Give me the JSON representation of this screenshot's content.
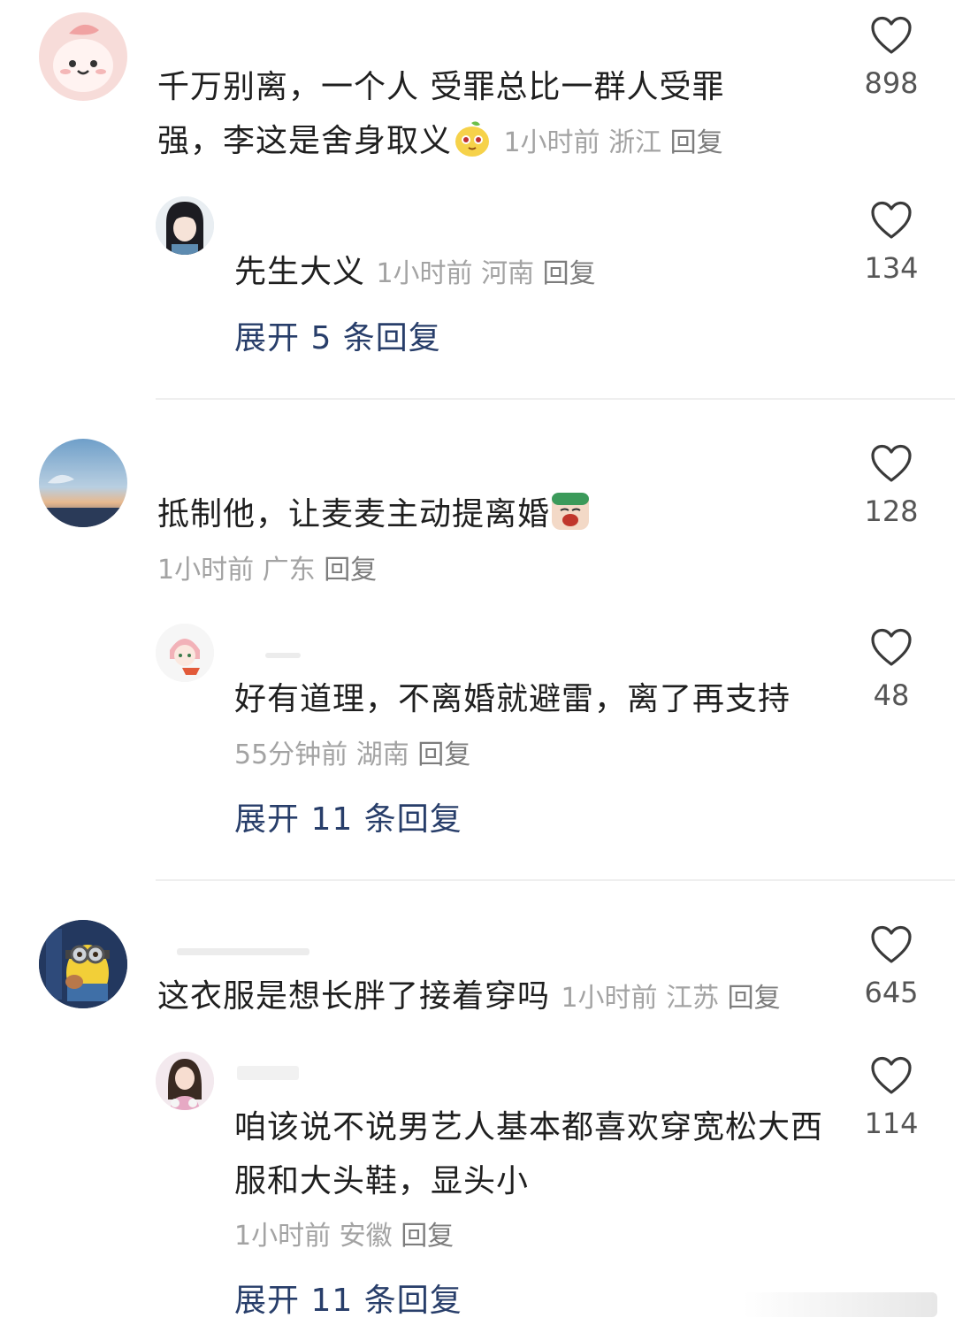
{
  "comments": [
    {
      "text": "千万别离，一个人 受罪总比一群人受罪强，李这是舍身取义",
      "meta": {
        "time": "1小时前",
        "location": "浙江",
        "reply": "回复"
      },
      "likes": "898",
      "sub_reply": {
        "text": "先生大义",
        "meta": {
          "time": "1小时前",
          "location": "河南",
          "reply": "回复"
        },
        "likes": "134"
      },
      "expand_label": "展开 5 条回复"
    },
    {
      "text": "抵制他，让麦麦主动提离婚",
      "meta": {
        "time": "1小时前",
        "location": "广东",
        "reply": "回复"
      },
      "likes": "128",
      "sub_reply": {
        "text": "好有道理，不离婚就避雷，离了再支持",
        "meta": {
          "time": "55分钟前",
          "location": "湖南",
          "reply": "回复"
        },
        "likes": "48"
      },
      "expand_label": "展开 11 条回复"
    },
    {
      "text": "这衣服是想长胖了接着穿吗",
      "meta": {
        "time": "1小时前",
        "location": "江苏",
        "reply": "回复"
      },
      "likes": "645",
      "sub_reply": {
        "text": "咱该说不说男艺人基本都喜欢穿宽松大西服和大头鞋，显头小",
        "meta": {
          "time": "1小时前",
          "location": "安徽",
          "reply": "回复"
        },
        "likes": "114"
      },
      "expand_label": "展开 11 条回复"
    }
  ],
  "icons": {
    "like": "heart-outline-icon"
  },
  "colors": {
    "link": "#283e6a",
    "meta": "#a3a3a3",
    "text": "#1f1f1f"
  }
}
